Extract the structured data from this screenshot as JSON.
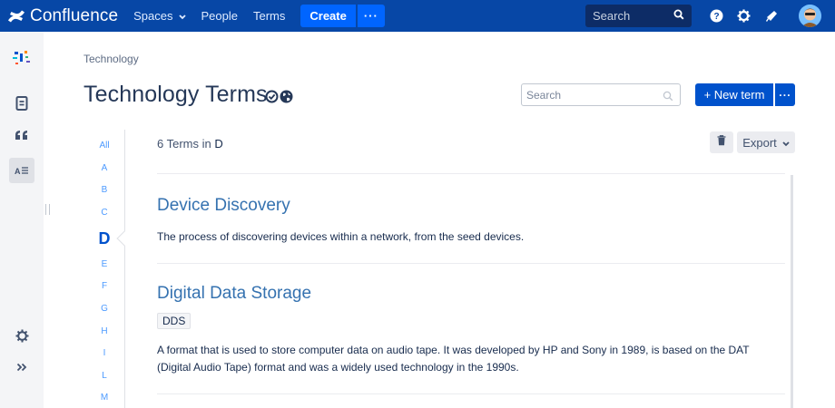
{
  "topnav": {
    "product": "Confluence",
    "items": [
      "Spaces",
      "People",
      "Terms"
    ],
    "create_label": "Create",
    "more_label": "···",
    "search_placeholder": "Search"
  },
  "breadcrumb": "Technology",
  "page": {
    "title": "Technology Terms",
    "search_placeholder": "Search",
    "new_term_label": "+ New term",
    "more_label": "···"
  },
  "alphabet": [
    "All",
    "A",
    "B",
    "C",
    "D",
    "E",
    "F",
    "G",
    "H",
    "I",
    "L",
    "M"
  ],
  "active_letter": "D",
  "count": {
    "text": "6 Terms in",
    "letter": "D"
  },
  "export_label": "Export",
  "terms": [
    {
      "title": "Device Discovery",
      "description": "The process of discovering devices within a network, from the seed devices."
    },
    {
      "title": "Digital Data Storage",
      "abbreviation": "DDS",
      "description": "A format that is used to store computer data on audio tape. It was developed by HP and Sony in 1989, is based on the DAT (Digital Audio Tape) format and was a widely used technology in the 1990s."
    }
  ],
  "colors": {
    "topbar": "#0747a6",
    "primary": "#0052cc",
    "link": "#3572b0",
    "letter": "#4c9aff"
  },
  "icons": {
    "logo": "confluence-logo-icon",
    "help": "help-icon",
    "settings": "gear-icon",
    "notifications": "megaphone-icon",
    "delete": "trash-icon"
  }
}
